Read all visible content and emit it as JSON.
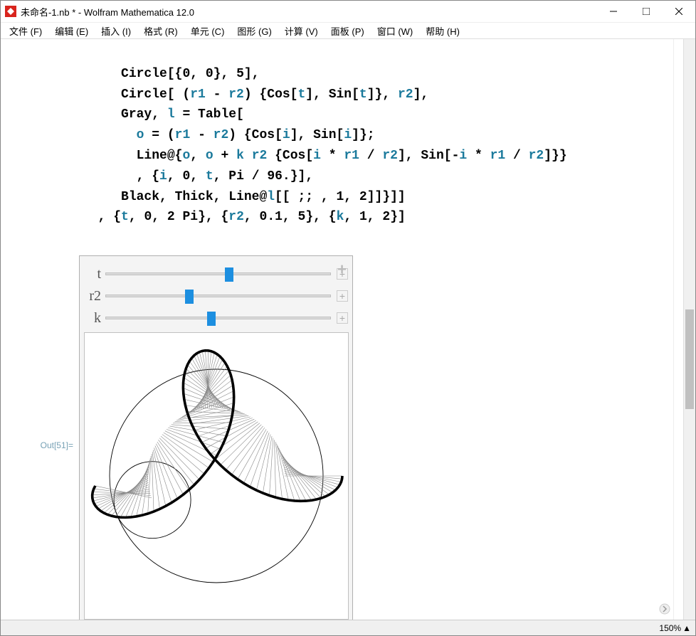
{
  "window": {
    "title": "未命名-1.nb * - Wolfram Mathematica 12.0"
  },
  "menu": {
    "file": "文件 (F)",
    "edit": "编辑 (E)",
    "insert": "插入 (I)",
    "format": "格式 (R)",
    "cell": "单元 (C)",
    "graph": "图形 (G)",
    "calc": "计算 (V)",
    "panel": "面板 (P)",
    "window": "窗口 (W)",
    "help": "帮助 (H)"
  },
  "code": {
    "l1": {
      "a": "Circle[{",
      "b": "0",
      "c": ", ",
      "d": "0",
      "e": "}, ",
      "f": "5",
      "g": "],"
    },
    "l2": {
      "a": "Circle[ (",
      "b": "r1",
      "c": " - ",
      "d": "r2",
      "e": ") {Cos[",
      "f": "t",
      "g": "], Sin[",
      "h": "t",
      "i": "]}, ",
      "j": "r2",
      "k": "],"
    },
    "l3": {
      "a": "Gray, ",
      "b": "l",
      "c": " = Table["
    },
    "l4": {
      "a": "o",
      "b": " = (",
      "c": "r1",
      "d": " - ",
      "e": "r2",
      "f": ") {Cos[",
      "g": "i",
      "h": "], Sin[",
      "i": "i",
      "j": "]};"
    },
    "l5": {
      "a": "Line@{",
      "b": "o",
      "c": ", ",
      "d": "o",
      "e": " + ",
      "f": "k",
      "g": " ",
      "h": "r2",
      "i": " {Cos[",
      "j": "i",
      "k": " * ",
      "l": "r1",
      "m": " / ",
      "n": "r2",
      "o": "], Sin[-",
      "p": "i",
      "q": " * ",
      "r": "r1",
      "s": " / ",
      "t": "r2",
      "u": "]}}"
    },
    "l6": {
      "a": ", {",
      "b": "i",
      "c": ", ",
      "d": "0",
      "e": ", ",
      "f": "t",
      "g": ", Pi / ",
      "h": "96.",
      "i": "}],"
    },
    "l7": {
      "a": "Black, Thick, Line@",
      "b": "l",
      "c": "[[ ;; , ",
      "d": "1",
      "e": ", ",
      "f": "2",
      "g": "]]}]]"
    },
    "l8": {
      "a": ", {",
      "b": "t",
      "c": ", ",
      "d": "0",
      "e": ", ",
      "f": "2",
      "g": " Pi}, {",
      "h": "r2",
      "i": ", ",
      "j": "0.1",
      "k": ", ",
      "l": "5",
      "m": "}, {",
      "n": "k",
      "o": ", ",
      "p": "1",
      "q": ", ",
      "r": "2",
      "s": "}]"
    }
  },
  "output_label": "Out[51]=",
  "sliders": {
    "t": {
      "label": "t",
      "position_pct": 55
    },
    "r2": {
      "label": "r2",
      "position_pct": 37
    },
    "k": {
      "label": "k",
      "position_pct": 47
    }
  },
  "manip": {
    "r1": 5,
    "r2": 1.8,
    "t": 3.5,
    "k": 1.5,
    "step_denom": 96
  },
  "status": {
    "zoom": "150%"
  }
}
